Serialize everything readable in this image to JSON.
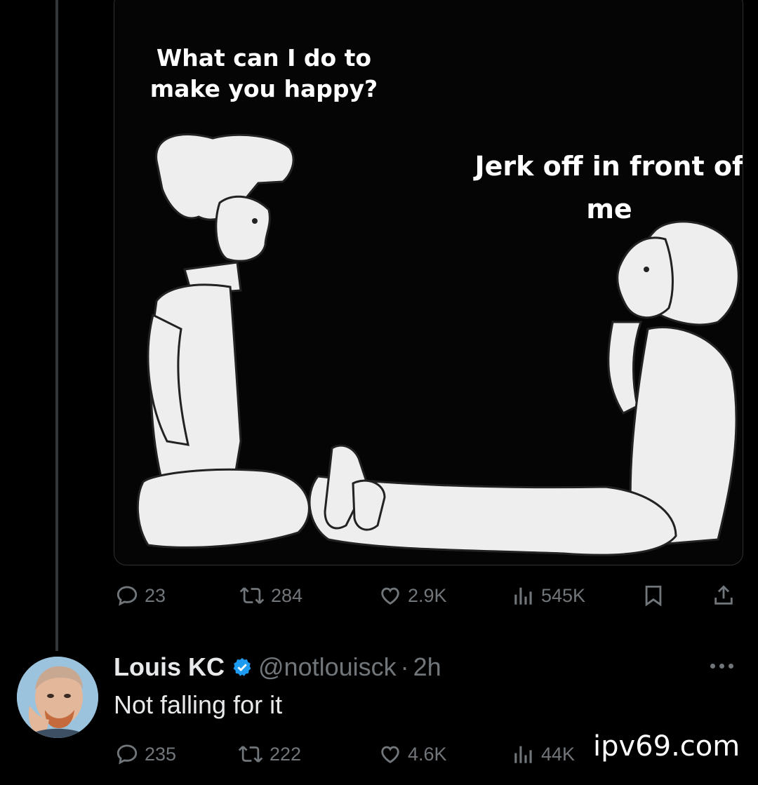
{
  "tweet": {
    "meme": {
      "speech_left": "What can I do to make you happy?",
      "speech_right": "Jerk off in front of me"
    },
    "actions": {
      "replies": "23",
      "reposts": "284",
      "likes": "2.9K",
      "views": "545K"
    }
  },
  "reply": {
    "name": "Louis KC",
    "handle": "@notlouisck",
    "separator": "·",
    "time": "2h",
    "text": "Not falling for it",
    "actions": {
      "replies": "235",
      "reposts": "222",
      "likes": "4.6K",
      "views": "44K"
    }
  },
  "watermark": "ipv69.com",
  "colors": {
    "background": "#000000",
    "text_primary": "#e7e9ea",
    "text_secondary": "#71767b",
    "verified": "#1d9bf0",
    "border": "#2f3336"
  },
  "icons": [
    "reply-icon",
    "repost-icon",
    "like-icon",
    "views-icon",
    "bookmark-icon",
    "share-icon",
    "verified-badge-icon",
    "more-icon"
  ]
}
